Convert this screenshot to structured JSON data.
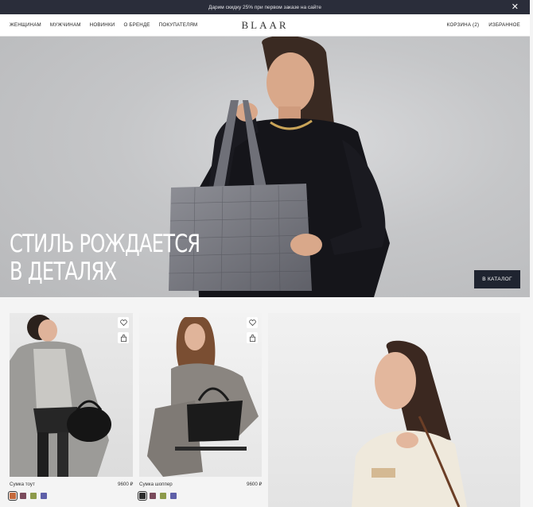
{
  "promo": {
    "text": "Дарим скидку 25% при первом заказе на сайте"
  },
  "header": {
    "nav": [
      "ЖЕНЩИНАМ",
      "МУЖЧИНАМ",
      "НОВИНКИ",
      "О БРЕНДЕ",
      "ПОКУПАТЕЛЯМ"
    ],
    "logo": "BLAAR",
    "cart": "КОРЗИНА (2)",
    "favorites": "ИЗБРАННОЕ"
  },
  "hero": {
    "title_line1": "СТИЛЬ РОЖДАЕТСЯ",
    "title_line2": "В ДЕТАЛЯХ",
    "button": "В КАТАЛОГ"
  },
  "products": [
    {
      "name": "Сумка тоут",
      "price": "9600 ₽",
      "swatches": [
        "#c56a3c",
        "#7a4a5c",
        "#8d9a4a",
        "#5e5fa8"
      ]
    },
    {
      "name": "Сумка шоппер",
      "price": "9600 ₽",
      "swatches": [
        "#2d2d2d",
        "#7a4a5c",
        "#8d9a4a",
        "#5e5fa8"
      ]
    }
  ],
  "colors": {
    "promo_bg": "#2a2d3a",
    "button_bg": "#1f2430"
  }
}
